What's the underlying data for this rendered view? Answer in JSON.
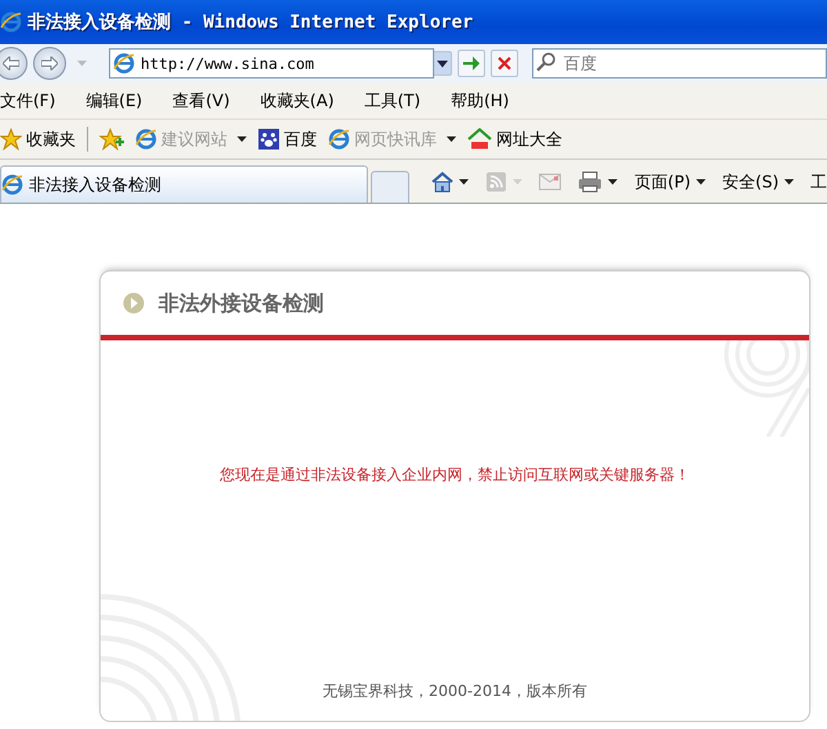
{
  "window": {
    "title": "非法接入设备检测 - Windows Internet Explorer"
  },
  "address_bar": {
    "value": "http://www.sina.com"
  },
  "search": {
    "placeholder": "百度"
  },
  "menu": [
    "文件(F)",
    "编辑(E)",
    "查看(V)",
    "收藏夹(A)",
    "工具(T)",
    "帮助(H)"
  ],
  "favorites_bar": [
    {
      "label": "收藏夹",
      "kind": "star",
      "disabled": false,
      "dropdown": false
    },
    {
      "label": "建议网站",
      "kind": "ie",
      "disabled": true,
      "dropdown": true
    },
    {
      "label": "百度",
      "kind": "paw",
      "disabled": false,
      "dropdown": false
    },
    {
      "label": "网页快讯库",
      "kind": "ie",
      "disabled": true,
      "dropdown": true
    },
    {
      "label": "网址大全",
      "kind": "house",
      "disabled": false,
      "dropdown": false
    }
  ],
  "tabs": [
    {
      "label": "非法接入设备检测",
      "selected": true
    }
  ],
  "command_bar": [
    {
      "kind": "home",
      "dropdown": true,
      "disabled": false
    },
    {
      "kind": "feed",
      "dropdown": true,
      "disabled": true
    },
    {
      "kind": "mail",
      "dropdown": false,
      "disabled": true
    },
    {
      "kind": "print",
      "dropdown": true,
      "disabled": false
    },
    {
      "kind": "text",
      "label": "页面(P)",
      "dropdown": true,
      "disabled": false
    },
    {
      "kind": "text",
      "label": "安全(S)",
      "dropdown": true,
      "disabled": false
    },
    {
      "kind": "text",
      "label": "工",
      "dropdown": false,
      "disabled": false
    }
  ],
  "card": {
    "title": "非法外接设备检测",
    "message": "您现在是通过非法设备接入企业内网，禁止访问互联网或关键服务器！",
    "footer": "无锡宝界科技，2000-2014，版本所有"
  }
}
